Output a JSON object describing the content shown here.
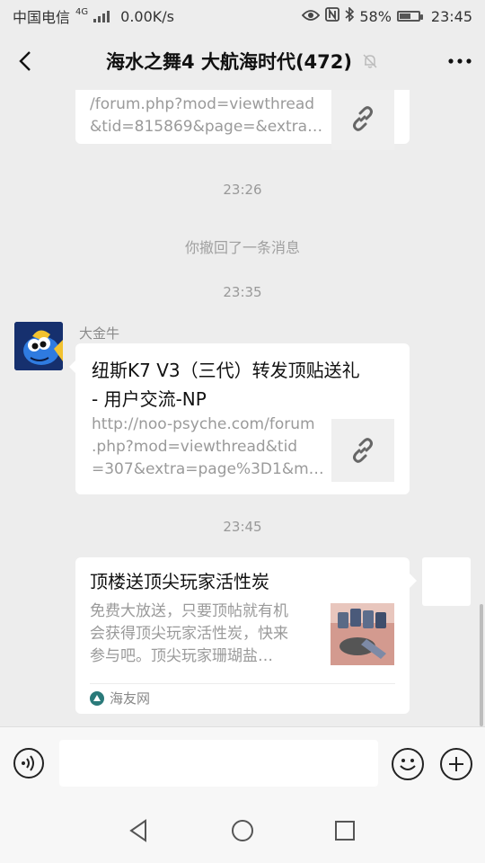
{
  "status_bar": {
    "carrier": "中国电信",
    "net_type": "4G",
    "speed": "0.00K/s",
    "battery_percent": "58%",
    "battery_level": 0.58,
    "time": "23:45",
    "icons": [
      "eye-icon",
      "nfc-icon",
      "bluetooth-icon",
      "battery-icon"
    ]
  },
  "header": {
    "title": "海水之舞4 大航海时代(472)",
    "back_icon": "chevron-left-icon",
    "mute_icon": "bell-off-icon",
    "more_icon": "more-icon"
  },
  "messages": {
    "card1": {
      "desc": "/forum.php?mod=viewthread\n&tid=815869&page=&extra…",
      "thumb_icon": "link-icon"
    },
    "time1": "23:26",
    "system1": "你撤回了一条消息",
    "time2": "23:35",
    "msg2": {
      "sender": "大金牛",
      "avatar_icon": "fish-avatar",
      "title": "纽斯K7 V3（三代）转发顶贴送礼\n- 用户交流-NP",
      "desc": "http://noo-psyche.com/forum\n.php?mod=viewthread&tid\n=307&extra=page%3D1&m…",
      "thumb_icon": "link-icon"
    },
    "time3": "23:45",
    "msg3": {
      "title": "顶楼送顶尖玩家活性炭",
      "desc": "免费大放送，只要顶帖就有机\n会获得顶尖玩家活性炭，快来\n参与吧。顶尖玩家珊瑚盐…",
      "source": "海友网",
      "source_icon": "site-logo-icon",
      "thumb_icon": "product-image"
    }
  },
  "input_bar": {
    "voice_icon": "voice-icon",
    "emoji_icon": "emoji-icon",
    "plus_icon": "plus-icon",
    "placeholder": ""
  },
  "nav_bar": {
    "icons": [
      "back-triangle-icon",
      "home-circle-icon",
      "recent-square-icon"
    ]
  }
}
